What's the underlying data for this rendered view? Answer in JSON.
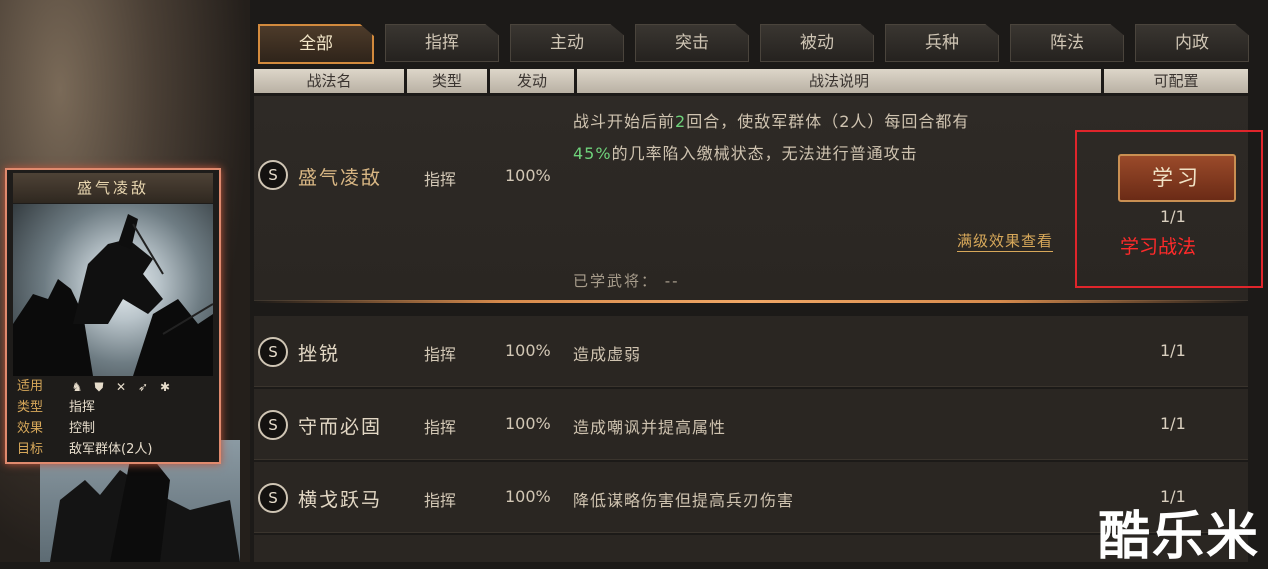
{
  "tabs": [
    "全部",
    "指挥",
    "主动",
    "突击",
    "被动",
    "兵种",
    "阵法",
    "内政"
  ],
  "headers": {
    "name": "战法名",
    "type": "类型",
    "trigger": "发动",
    "desc": "战法说明",
    "cfg": "可配置"
  },
  "card": {
    "title": "盛气凌敌",
    "rows": [
      {
        "key": "适用",
        "val": ""
      },
      {
        "key": "类型",
        "val": "指挥"
      },
      {
        "key": "效果",
        "val": "控制"
      },
      {
        "key": "目标",
        "val": "敌军群体(2人)"
      }
    ],
    "troop_icons": [
      "cavalry-icon",
      "shield-icon",
      "bow-icon",
      "spear-icon",
      "siege-icon"
    ]
  },
  "selected": {
    "grade": "S",
    "name": "盛气凌敌",
    "type": "指挥",
    "pct": "100%",
    "desc1_a": "战斗开始后前",
    "desc1_num": "2",
    "desc1_b": "回合，使敌军群体（2人）每回合都有",
    "desc2_num": "45%",
    "desc2_b": "的几率陷入缴械状态，无法进行普通攻击",
    "learn": "学习",
    "cfg": "1/1",
    "full_link": "满级效果查看",
    "learned": "已学武将：  --"
  },
  "rows": [
    {
      "grade": "S",
      "name": "挫锐",
      "type": "指挥",
      "pct": "100%",
      "desc": "造成虚弱",
      "cfg": "1/1"
    },
    {
      "grade": "S",
      "name": "守而必固",
      "type": "指挥",
      "pct": "100%",
      "desc": "造成嘲讽并提高属性",
      "cfg": "1/1"
    },
    {
      "grade": "S",
      "name": "横戈跃马",
      "type": "指挥",
      "pct": "100%",
      "desc": "降低谋略伤害但提高兵刃伤害",
      "cfg": "1/1"
    }
  ],
  "annotation": "学习战法",
  "watermark": "酷乐米"
}
